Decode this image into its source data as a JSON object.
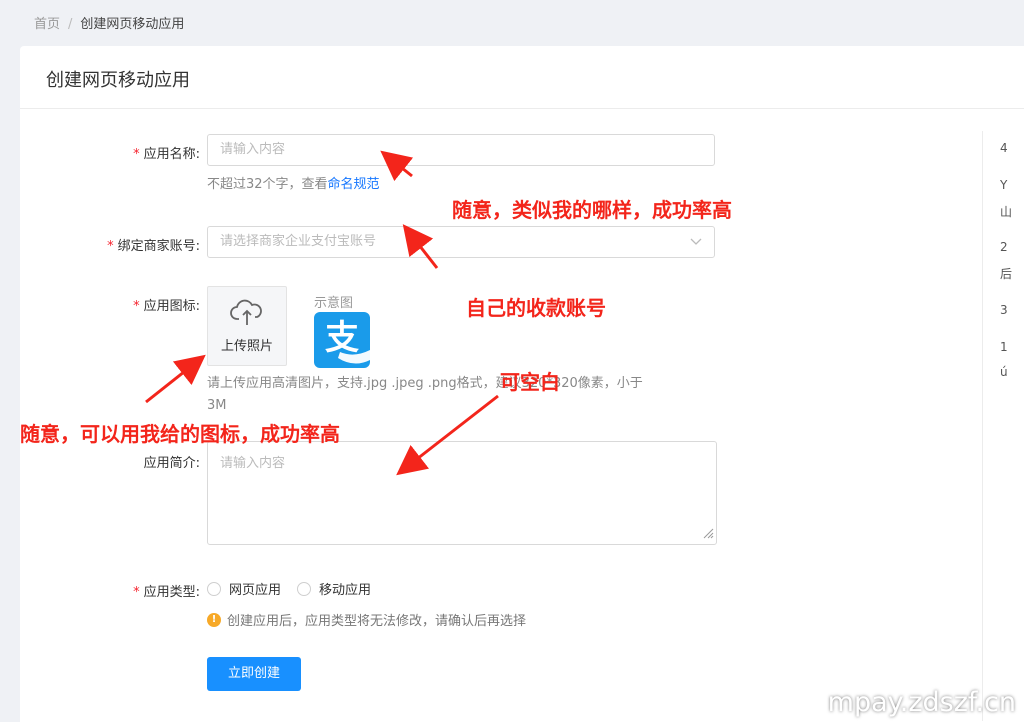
{
  "breadcrumb": {
    "home": "首页",
    "separator": "/",
    "current": "创建网页移动应用"
  },
  "page": {
    "title": "创建网页移动应用"
  },
  "form": {
    "required_mark": "*",
    "name": {
      "label": "应用名称:",
      "placeholder": "请输入内容",
      "hint_prefix": "不超过32个字，查看",
      "hint_link": "命名规范"
    },
    "merchant": {
      "label": "绑定商家账号:",
      "placeholder": "请选择商家企业支付宝账号"
    },
    "icon": {
      "label": "应用图标:",
      "upload_label": "上传照片",
      "demo_label": "示意图",
      "logo_glyph": "支",
      "hint_line1": "请上传应用高清图片，支持.jpg .jpeg .png格式，建议320*320像素，小于",
      "hint_line2": "3M"
    },
    "intro": {
      "label": "应用简介:",
      "placeholder": "请输入内容"
    },
    "type": {
      "label": "应用类型:",
      "options": [
        "网页应用",
        "移动应用"
      ],
      "notice_icon": "!",
      "notice": "创建应用后，应用类型将无法修改，请确认后再选择"
    },
    "submit_label": "立即创建"
  },
  "right_fragments": [
    "4",
    "Y",
    "山",
    "2",
    "后",
    "3",
    "1",
    "ú"
  ],
  "annotations": {
    "name_note": "随意，类似我的哪样，成功率高",
    "account_note": "自己的收款账号",
    "blank_note": "可空白",
    "icon_note": "随意，可以用我给的图标，成功率高",
    "color": "#f3251b"
  },
  "watermark": "mpay.zdszf.cn",
  "colors": {
    "primary": "#1890ff",
    "link": "#1677ff",
    "required": "#f5222d",
    "warning": "#f7a928",
    "alipay": "#1a9bea"
  }
}
